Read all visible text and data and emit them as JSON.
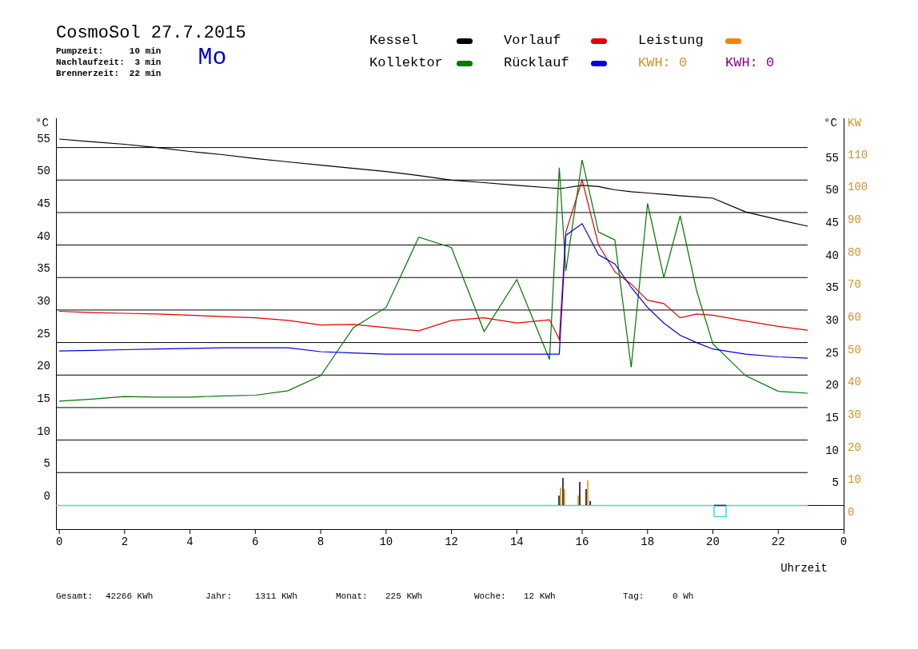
{
  "header": {
    "title": "CosmoSol 27.7.2015",
    "weekday": "Mo",
    "stats": [
      {
        "label": "Pumpzeit:",
        "value": "10 min"
      },
      {
        "label": "Nachlaufzeit:",
        "value": "3 min"
      },
      {
        "label": "Brennerzeit:",
        "value": "22 min"
      }
    ]
  },
  "legend": [
    {
      "kind": "series",
      "label": "Leistung",
      "color": "#ff8000"
    },
    {
      "kind": "total",
      "label": "KWH: 0",
      "color": "#d4902a"
    },
    {
      "kind": "total",
      "label": "KWH: 0",
      "color": "#800080"
    }
  ],
  "chart": {
    "right_unit": "°C",
    "power_unit": "KW",
    "x_end_label": "0",
    "right_ticks": [
      "55",
      "50",
      "45",
      "40",
      "35",
      "30",
      "25",
      "20",
      "15",
      "10",
      "5"
    ],
    "power_ticks": [
      "110",
      "100",
      "90",
      "80",
      "70",
      "60",
      "50",
      "40",
      "30",
      "20",
      "10",
      "0"
    ],
    "chart_data": {
      "type": "line",
      "xlabel": "Uhrzeit",
      "ylabel": "°C",
      "xlim": [
        -0.1,
        24
      ],
      "ylim": [
        -3.7,
        59.5
      ],
      "grid": true,
      "xticks": [
        0,
        2,
        4,
        6,
        8,
        10,
        12,
        14,
        16,
        18,
        20,
        22
      ],
      "yticks": [
        0,
        5,
        10,
        15,
        20,
        25,
        30,
        35,
        40,
        45,
        50,
        55
      ],
      "ref_lines": [
        {
          "axis": "y",
          "value": 0,
          "color": "#40d8e0"
        }
      ],
      "x": [
        0,
        1,
        2,
        3,
        4,
        5,
        6,
        7,
        8,
        9,
        10,
        11,
        12,
        13,
        14,
        15,
        15.3,
        15.5,
        16,
        16.5,
        17,
        17.5,
        18,
        18.5,
        19,
        19.5,
        20,
        21,
        22,
        22.9
      ],
      "series": [
        {
          "name": "Kessel",
          "color": "#000000",
          "values": [
            56.3,
            55.9,
            55.5,
            55,
            54.4,
            53.9,
            53.3,
            52.8,
            52.3,
            51.8,
            51.3,
            50.7,
            50,
            49.6,
            49.2,
            48.8,
            48.7,
            48.8,
            49.2,
            49,
            48.5,
            48.2,
            48,
            47.8,
            47.6,
            47.4,
            47.2,
            45.1,
            43.9,
            42.9
          ]
        },
        {
          "name": "Vorlauf",
          "color": "#e00000",
          "values": [
            29.8,
            29.6,
            29.5,
            29.4,
            29.2,
            29,
            28.8,
            28.4,
            27.7,
            27.8,
            27.3,
            26.8,
            28.4,
            28.8,
            28,
            28.5,
            25.5,
            42,
            50,
            40,
            35.9,
            34,
            31.5,
            31,
            28.8,
            29.4,
            29.2,
            28.3,
            27.5,
            26.9
          ]
        },
        {
          "name": "Kollektor",
          "color": "#007800",
          "values": [
            16,
            16.3,
            16.7,
            16.6,
            16.6,
            16.8,
            16.9,
            17.6,
            19.9,
            27.3,
            30.4,
            41.2,
            39.6,
            26.7,
            34.7,
            22.4,
            51.9,
            36,
            53.1,
            42,
            40.8,
            21.2,
            46.4,
            35,
            44.5,
            33,
            24.8,
            19.9,
            17.5,
            17.2
          ]
        },
        {
          "name": "Rücklauf",
          "color": "#0000e0",
          "values": [
            23.7,
            23.8,
            23.9,
            24,
            24.1,
            24.2,
            24.2,
            24.2,
            23.6,
            23.4,
            23.2,
            23.2,
            23.2,
            23.2,
            23.2,
            23.2,
            23.2,
            41.5,
            43.3,
            38.5,
            37.1,
            33.5,
            30.4,
            28,
            26.1,
            25,
            24,
            23.2,
            22.8,
            22.6
          ]
        }
      ]
    }
  },
  "totals": [
    {
      "label": "Gesamt:",
      "value": "42266 KWh"
    },
    {
      "label": "Jahr:",
      "value": "1311 KWh"
    },
    {
      "label": "Monat:",
      "value": "225 KWh"
    },
    {
      "label": "Woche:",
      "value": "12 KWh"
    },
    {
      "label": "Tag:",
      "value": "0 Wh"
    }
  ]
}
